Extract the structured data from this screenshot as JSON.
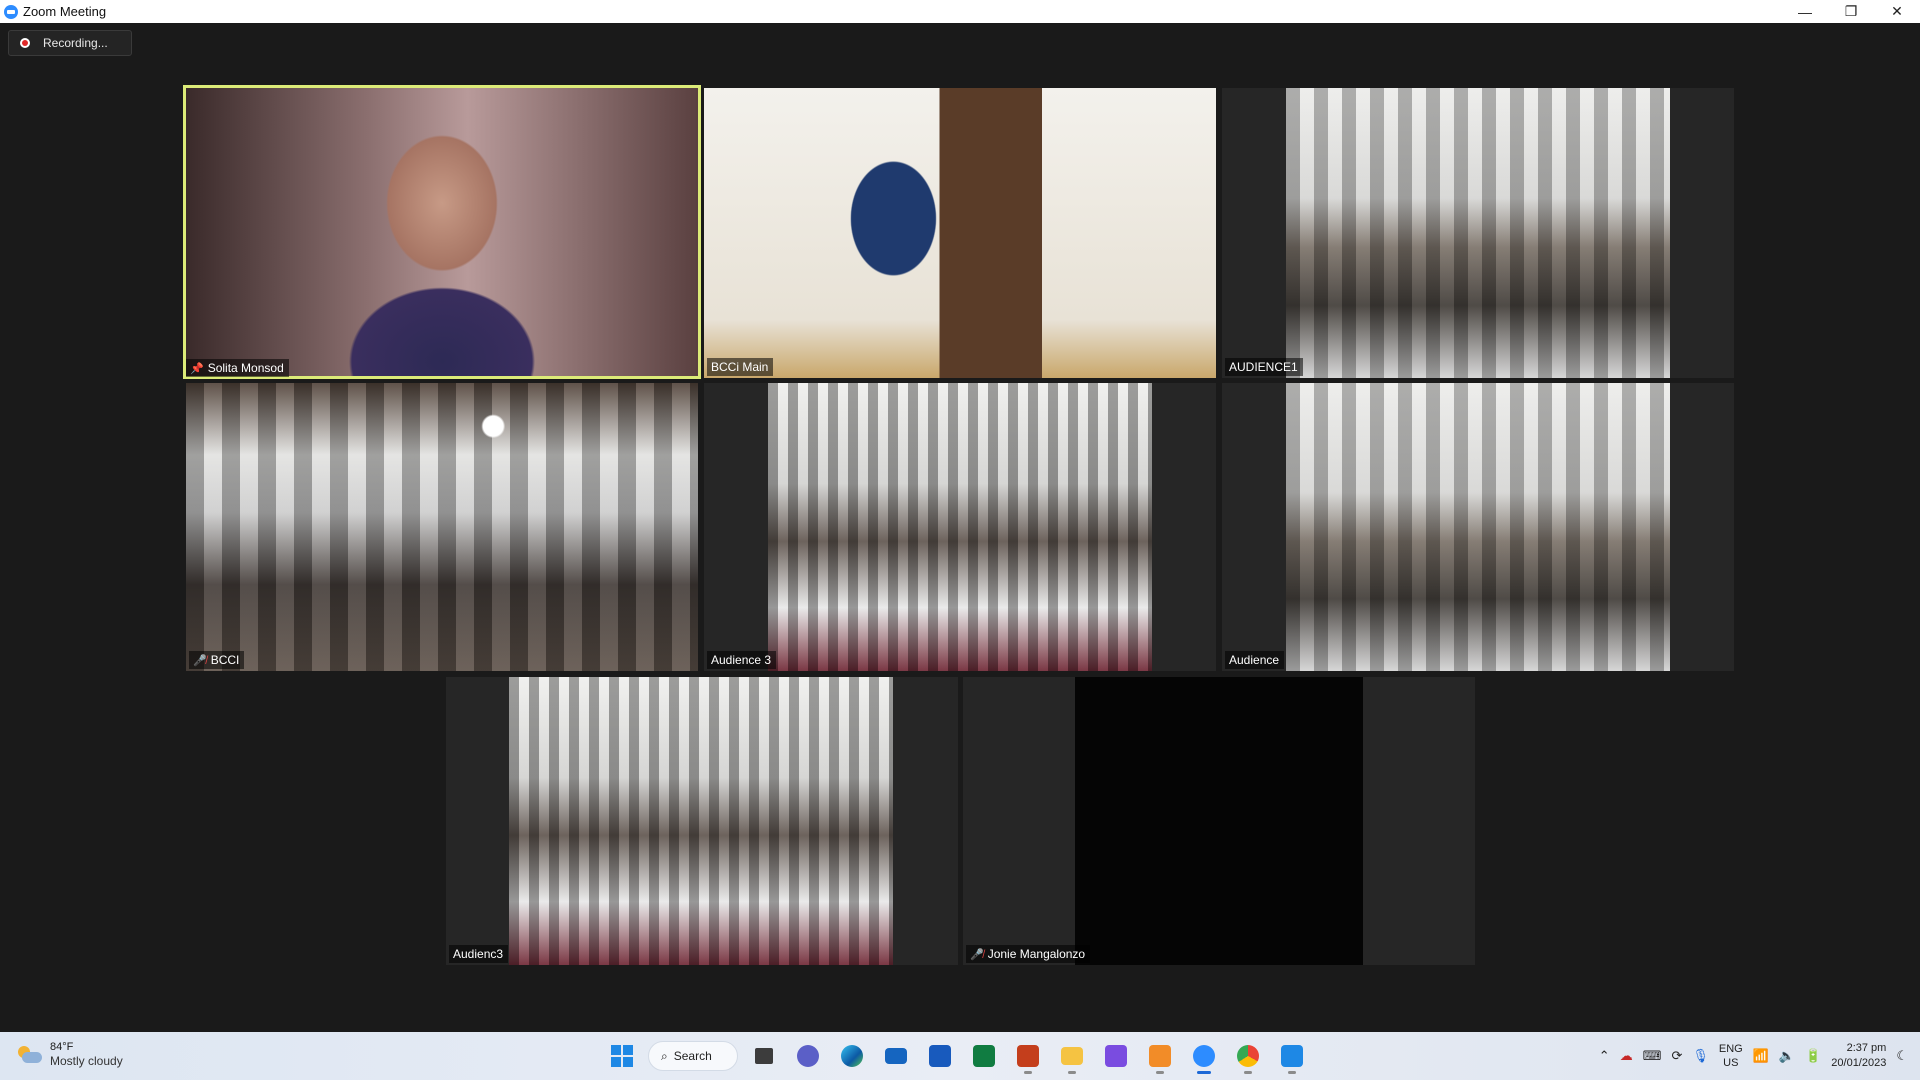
{
  "window": {
    "title": "Zoom Meeting",
    "controls": [
      "—",
      "❐",
      "✕"
    ]
  },
  "recording": {
    "label": "Recording..."
  },
  "tiles": [
    {
      "name": "Solita Monsod",
      "icon": "pin-icon",
      "active": true
    },
    {
      "name": "BCCi Main",
      "icon": "",
      "active": false
    },
    {
      "name": "AUDIENCE1",
      "icon": "",
      "active": false
    },
    {
      "name": "BCCI",
      "icon": "muted-icon",
      "active": false
    },
    {
      "name": "Audience 3",
      "icon": "",
      "active": false
    },
    {
      "name": "Audience",
      "icon": "",
      "active": false
    },
    {
      "name": "Audienc3",
      "icon": "",
      "active": false
    },
    {
      "name": "Jonie Mangalonzo",
      "icon": "muted-icon",
      "active": false
    }
  ],
  "taskbar": {
    "weather": {
      "temp": "84°F",
      "condition": "Mostly cloudy"
    },
    "search_label": "Search",
    "apps": [
      {
        "name": "start",
        "color": "#1e88e5"
      },
      {
        "name": "search",
        "color": "#f7f9fc"
      },
      {
        "name": "task-view",
        "color": "#3c3c3c"
      },
      {
        "name": "teams",
        "color": "#5b5fc7"
      },
      {
        "name": "edge",
        "color": "#1f8ac9"
      },
      {
        "name": "mail",
        "color": "#1565c0"
      },
      {
        "name": "word",
        "color": "#185abd"
      },
      {
        "name": "excel",
        "color": "#107c41"
      },
      {
        "name": "powerpoint",
        "color": "#c43e1c"
      },
      {
        "name": "file-explorer",
        "color": "#f5c342"
      },
      {
        "name": "clipchamp",
        "color": "#7a4ce0"
      },
      {
        "name": "app-orange",
        "color": "#f28c28"
      },
      {
        "name": "zoom",
        "color": "#2d8cff"
      },
      {
        "name": "chrome",
        "color": "#34a853"
      },
      {
        "name": "camera",
        "color": "#1e88e5"
      }
    ],
    "tray": {
      "lang_top": "ENG",
      "lang_bottom": "US",
      "time": "2:37 pm",
      "date": "20/01/2023"
    }
  }
}
